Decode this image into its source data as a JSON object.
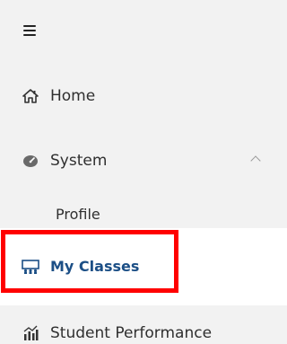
{
  "sidebar": {
    "menu_icon": "hamburger-icon",
    "items": [
      {
        "id": "home",
        "label": "Home",
        "icon": "home-icon"
      },
      {
        "id": "system",
        "label": "System",
        "icon": "gauge-icon",
        "expanded": true,
        "chevron": "chevron-up-icon"
      },
      {
        "id": "profile",
        "label": "Profile",
        "sub_item": true
      },
      {
        "id": "my-classes",
        "label": "My Classes",
        "icon": "classroom-icon",
        "active": true
      },
      {
        "id": "student-performance",
        "label": "Student Performance",
        "icon": "bar-chart-icon"
      }
    ]
  },
  "colors": {
    "background": "#f2f2f2",
    "active_background": "#ffffff",
    "active_text": "#1c4f86",
    "text": "#2f2f2f",
    "highlight": "#ff0000"
  }
}
